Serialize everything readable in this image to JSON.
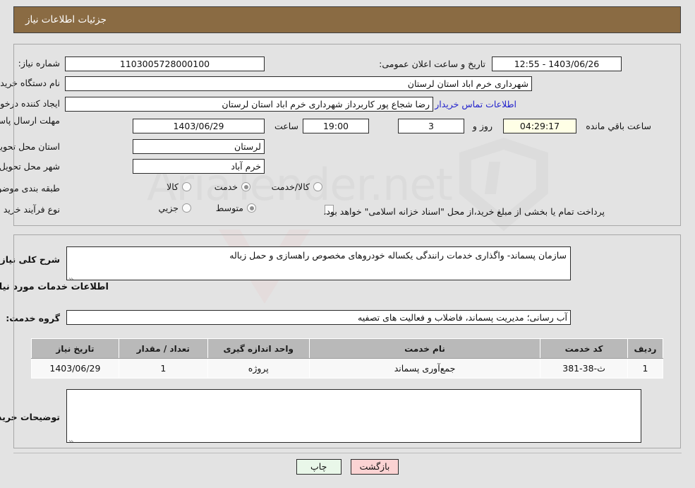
{
  "header": {
    "title": "جزئیات اطلاعات نیاز"
  },
  "top_section": {
    "need_number_label": "شماره نیاز:",
    "need_number_value": "1103005728000100",
    "announce_label": "تاریخ و ساعت اعلان عمومی:",
    "announce_value": "1403/06/26 - 12:55",
    "buyer_org_label": "نام دستگاه خریدار:",
    "buyer_org_value": "شهرداری خرم اباد استان لرستان",
    "creator_label": "ایجاد کننده درخواست:",
    "creator_value": "رضا شجاع پور کاربرداز شهرداری خرم اباد استان لرستان",
    "contact_link": "اطلاعات تماس خریدار",
    "deadline_label": "مهلت ارسال پاسخ: تا تاریخ:",
    "deadline_date": "1403/06/29",
    "hour_label": "ساعت",
    "deadline_time": "19:00",
    "days_value": "3",
    "days_label": "روز و",
    "countdown_value": "04:29:17",
    "countdown_label": "ساعت باقي مانده",
    "province_label": "استان محل تحویل:",
    "province_value": "لرستان",
    "city_label": "شهر محل تحویل:",
    "city_value": "خرم آباد",
    "category_label": "طبقه بندی موضوعی:",
    "category_options": [
      {
        "label": "کالا",
        "selected": false
      },
      {
        "label": "خدمت",
        "selected": true
      },
      {
        "label": "کالا/خدمت",
        "selected": false
      }
    ],
    "process_label": "نوع فرآیند خرید :",
    "process_options": [
      {
        "label": "جزیي",
        "selected": false
      },
      {
        "label": "متوسط",
        "selected": true
      }
    ],
    "treasury_checkbox_label": "پرداخت تمام یا بخشی از مبلغ خرید،از محل \"اسناد خزانه اسلامی\" خواهد بود.",
    "treasury_checked": false
  },
  "bottom_section": {
    "summary_label": "شرح کلی نیاز:",
    "summary_value": "سازمان پسماند- واگذاری خدمات رانندگی یکساله خودروهای مخصوص راهسازی و حمل زباله",
    "services_heading": "اطلاعات خدمات مورد نیاز",
    "service_group_label": "گروه خدمت:",
    "service_group_value": "آب رسانی؛ مدیریت پسماند، فاضلاب و فعالیت های تصفیه",
    "table": {
      "columns": [
        "ردیف",
        "کد خدمت",
        "نام خدمت",
        "واحد اندازه گیری",
        "تعداد / مقدار",
        "تاریخ نیاز"
      ],
      "rows": [
        [
          "1",
          "ث-38-381",
          "جمع‌آوری پسماند",
          "پروژه",
          "1",
          "1403/06/29"
        ]
      ]
    },
    "buyer_notes_label": "توضیحات خریدار:",
    "buyer_notes_value": ""
  },
  "footer": {
    "print_label": "چاپ",
    "back_label": "بازگشت"
  },
  "watermark": {
    "text": "AriaTender.net"
  },
  "colors": {
    "header_bg": "#8a6b43",
    "page_bg": "#e3e3e3",
    "link": "#2222cc",
    "table_header_bg": "#b9b9b9",
    "print_btn_bg": "#e9f7e9",
    "back_btn_bg": "#fbd3d3",
    "countdown_bg": "#ffffe6"
  }
}
